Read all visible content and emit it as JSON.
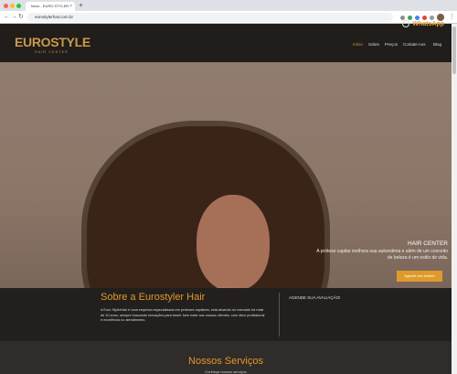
{
  "browser": {
    "tab_title": "Inicio - EURO STYLER",
    "tab_close": "×",
    "new_tab": "+",
    "url": "eurostylerhair.com.br",
    "back": "←",
    "forward": "→",
    "reload": "↻",
    "menu": "⋮",
    "colors": {
      "close": "#ff5f57",
      "minimize": "#febc2e",
      "maximize": "#28c840"
    }
  },
  "header": {
    "whatsapp_label": "WhatsApp",
    "logo_text": "EUROSTYLE",
    "logo_subtitle": "HAIR CENTER",
    "nav": [
      "Início",
      "Sobre",
      "Preços",
      "Contate-nos",
      "Blog"
    ],
    "active_color": "#e09a2c"
  },
  "hero": {
    "title": "HAIR CENTER",
    "text": "A prótese capilar melhora sua autoestima e além de um conceito de beleza é um estilo de vida.",
    "button_label": "Agende seu horário"
  },
  "about": {
    "title": "Sobre a Eurostyler Hair",
    "text": "A Euro StylerHair é uma empresa especializada em próteses capilares, está atuando no mercado há mais de 10 anos, sempre buscando inovações para trazer bem estar aos nossos clientes, com ótico profissional e excelência no atendimento.",
    "rating_label": "AGENDE SUA AVALIAÇÃO!"
  },
  "services": {
    "title": "Nossos Serviços",
    "subtitle": "Conheça nossos serviços"
  }
}
